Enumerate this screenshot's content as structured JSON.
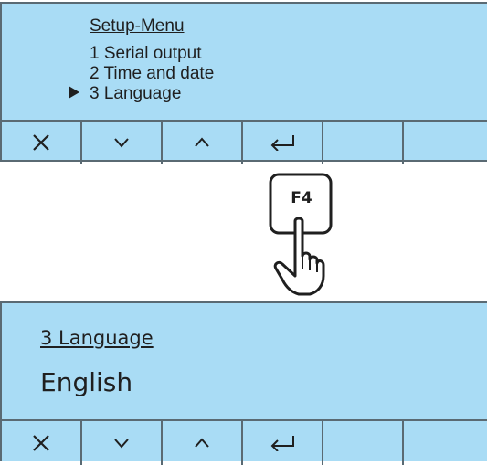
{
  "menu_screen": {
    "title": "Setup-Menu",
    "items": [
      "1 Serial output",
      "2 Time and date",
      "3 Language"
    ],
    "selected_index": 2
  },
  "key": {
    "label": "F4"
  },
  "language_screen": {
    "title": "3 Language",
    "value": "English"
  },
  "softkeys": [
    {
      "icon": "close-icon"
    },
    {
      "icon": "chevron-down-icon"
    },
    {
      "icon": "chevron-up-icon"
    },
    {
      "icon": "enter-icon"
    },
    {
      "icon": ""
    },
    {
      "icon": ""
    }
  ],
  "colors": {
    "screen_background": "#a9dcf5",
    "border": "#5a6a73",
    "text": "#1f1f1f"
  }
}
